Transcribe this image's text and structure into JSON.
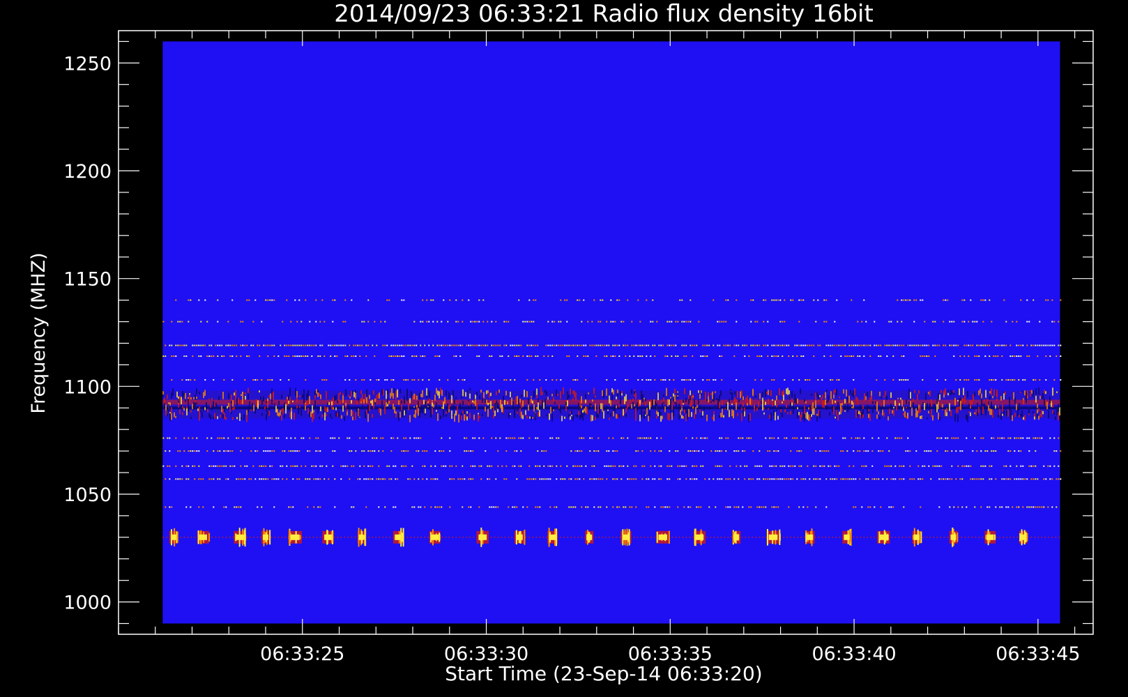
{
  "chart_data": {
    "type": "heatmap",
    "title": "2014/09/23 06:33:21 Radio flux density 16bit",
    "xlabel": "Start Time (23-Sep-14 06:33:20)",
    "ylabel": "Frequency (MHZ)",
    "x_range_seconds": [
      20.0,
      46.5
    ],
    "data_x_range_seconds": [
      21.2,
      45.6
    ],
    "ylim": [
      985,
      1265
    ],
    "data_ylim": [
      990,
      1260
    ],
    "x_ticks": [
      {
        "value": 25,
        "label": "06:33:25"
      },
      {
        "value": 30,
        "label": "06:33:30"
      },
      {
        "value": 35,
        "label": "06:33:35"
      },
      {
        "value": 40,
        "label": "06:33:40"
      },
      {
        "value": 45,
        "label": "06:33:45"
      }
    ],
    "y_ticks": [
      {
        "value": 1000,
        "label": "1000"
      },
      {
        "value": 1050,
        "label": "1050"
      },
      {
        "value": 1100,
        "label": "1100"
      },
      {
        "value": 1150,
        "label": "1150"
      },
      {
        "value": 1200,
        "label": "1200"
      },
      {
        "value": 1250,
        "label": "1250"
      }
    ],
    "x_minor_step": 1,
    "y_minor_step": 10,
    "colors": {
      "background": "#000000",
      "axes": "#ffffff",
      "baseline": "#1e10f2",
      "dark": "#08086a",
      "red": "#d71c10",
      "orange": "#ff8a00",
      "yellow": "#ffee40"
    },
    "emission_lines": [
      {
        "freq": 1140,
        "intensity": 0.3
      },
      {
        "freq": 1130,
        "intensity": 0.35
      },
      {
        "freq": 1119,
        "intensity": 0.8
      },
      {
        "freq": 1114,
        "intensity": 0.45
      },
      {
        "freq": 1103,
        "intensity": 0.35
      },
      {
        "freq": 1076,
        "intensity": 0.45
      },
      {
        "freq": 1070,
        "intensity": 0.4
      },
      {
        "freq": 1063,
        "intensity": 0.55
      },
      {
        "freq": 1057,
        "intensity": 0.6
      },
      {
        "freq": 1044,
        "intensity": 0.35
      }
    ],
    "interference_band": [
      1085,
      1098
    ],
    "pulse_train": {
      "freq": 1030,
      "times": [
        21.5,
        22.3,
        23.3,
        24.0,
        24.8,
        25.7,
        26.6,
        27.6,
        28.6,
        29.9,
        30.9,
        31.8,
        32.8,
        33.8,
        34.8,
        35.8,
        36.8,
        37.8,
        38.8,
        39.8,
        40.8,
        41.7,
        42.7,
        43.7,
        44.6
      ]
    }
  }
}
